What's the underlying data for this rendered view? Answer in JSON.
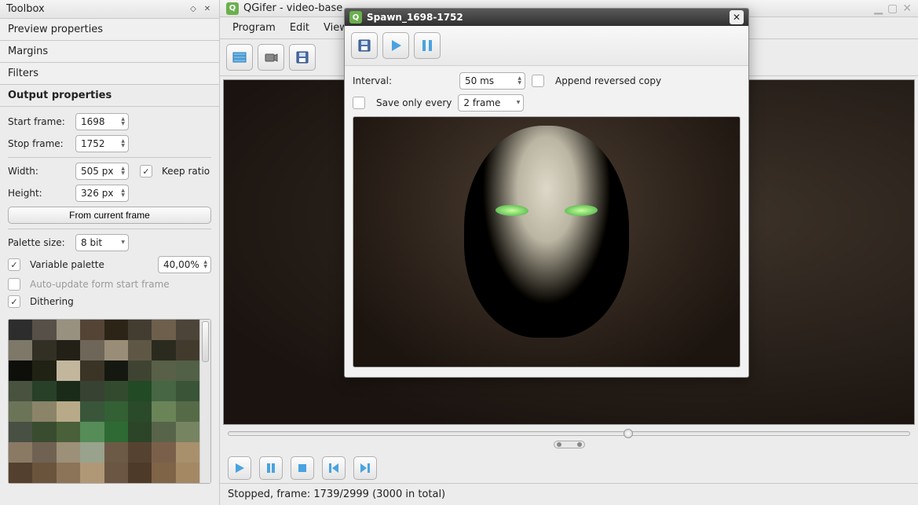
{
  "toolbox": {
    "title": "Toolbox",
    "sections": {
      "preview": "Preview properties",
      "margins": "Margins",
      "filters": "Filters",
      "output": "Output properties"
    },
    "start_frame_label": "Start frame:",
    "start_frame_value": "1698",
    "stop_frame_label": "Stop frame:",
    "stop_frame_value": "1752",
    "width_label": "Width:",
    "width_value": "505 px",
    "height_label": "Height:",
    "height_value": "326 px",
    "keep_ratio_label": "Keep ratio",
    "from_current_btn": "From current frame",
    "palette_size_label": "Palette size:",
    "palette_size_value": "8 bit",
    "variable_palette_label": "Variable palette",
    "variable_palette_pct": "40,00%",
    "auto_update_label": "Auto-update form start frame",
    "dithering_label": "Dithering"
  },
  "main_window": {
    "title": "QGifer - video-base",
    "menu": {
      "program": "Program",
      "edit": "Edit",
      "view": "View"
    },
    "status": "Stopped, frame: 1739/2999 (3000 in total)"
  },
  "dialog": {
    "title": "Spawn_1698-1752",
    "interval_label": "Interval:",
    "interval_value": "50 ms",
    "append_reversed_label": "Append reversed copy",
    "save_only_every_label": "Save only every",
    "save_only_every_value": "2 frame"
  },
  "palette_colors": [
    "#2d2d2d",
    "#565048",
    "#98917f",
    "#544436",
    "#2d2418",
    "#433c31",
    "#6d5f4b",
    "#4c4439",
    "#7e7869",
    "#322f24",
    "#232018",
    "#6e6658",
    "#9a8d78",
    "#5f5745",
    "#2a2b1e",
    "#433a2e",
    "#0e0f0a",
    "#202214",
    "#c2b69d",
    "#3a3426",
    "#151811",
    "#3f4432",
    "#586048",
    "#516046",
    "#48523e",
    "#284028",
    "#1b2b1a",
    "#384232",
    "#344a2e",
    "#224a24",
    "#466644",
    "#3a5438",
    "#6c7458",
    "#8b8468",
    "#b8aa88",
    "#39563a",
    "#346035",
    "#2a4a2a",
    "#6a8458",
    "#566a48",
    "#485044",
    "#3a4c30",
    "#4a603a",
    "#568c58",
    "#2e6a34",
    "#2c4428",
    "#58644a",
    "#768462",
    "#8a7a64",
    "#706252",
    "#9c9078",
    "#98a28c",
    "#6c5a46",
    "#564230",
    "#7a604a",
    "#a8906c",
    "#54402e",
    "#6a543c",
    "#8c7458",
    "#b09876",
    "#6a5642",
    "#4e3a28",
    "#806448",
    "#a48864"
  ]
}
